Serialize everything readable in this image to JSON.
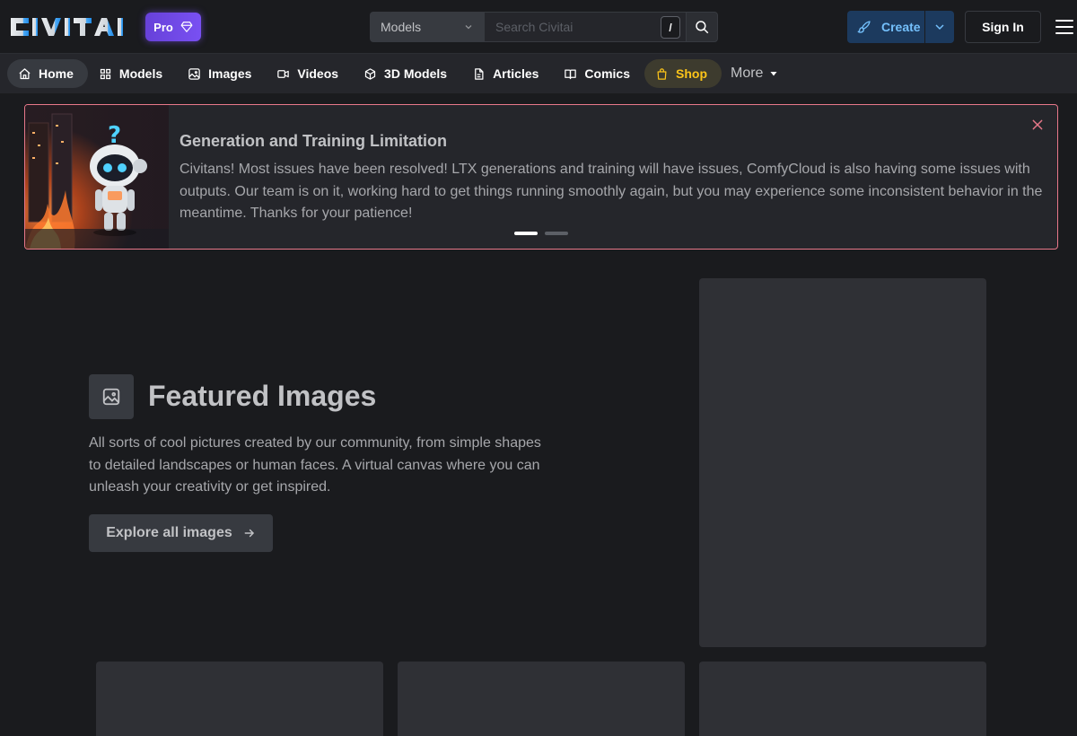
{
  "header": {
    "logo_text": "CIVITAI",
    "pro_label": "Pro",
    "search": {
      "category": "Models",
      "placeholder": "Search Civitai",
      "shortcut": "/"
    },
    "create_label": "Create",
    "signin_label": "Sign In"
  },
  "nav": {
    "items": [
      {
        "label": "Home",
        "icon": "home-icon"
      },
      {
        "label": "Models",
        "icon": "grid-icon"
      },
      {
        "label": "Images",
        "icon": "image-icon"
      },
      {
        "label": "Videos",
        "icon": "video-icon"
      },
      {
        "label": "3D Models",
        "icon": "cube-icon"
      },
      {
        "label": "Articles",
        "icon": "file-icon"
      },
      {
        "label": "Comics",
        "icon": "book-icon"
      },
      {
        "label": "Shop",
        "icon": "shopping-bag-icon"
      }
    ],
    "more_label": "More"
  },
  "announcement": {
    "title": "Generation and Training Limitation",
    "body": "Civitans! Most issues have been resolved! LTX generations and training will have issues, ComfyCloud is also having some issues with outputs. Our team is on it, working hard to get things running smoothly again, but you may experience some inconsistent behavior in the meantime. Thanks for your patience!",
    "active_slide": 1,
    "slide_count": 2
  },
  "featured": {
    "title": "Featured Images",
    "description": "All sorts of cool pictures created by our community, from simple shapes to detailed landscapes or human faces. A virtual canvas where you can unleash your creativity or get inspired.",
    "button_label": "Explore all images"
  },
  "colors": {
    "accent_blue": "#74c0fc",
    "pro_purple": "#7950f2",
    "shop_yellow": "#fcc419",
    "announce_border": "#e8788a"
  }
}
